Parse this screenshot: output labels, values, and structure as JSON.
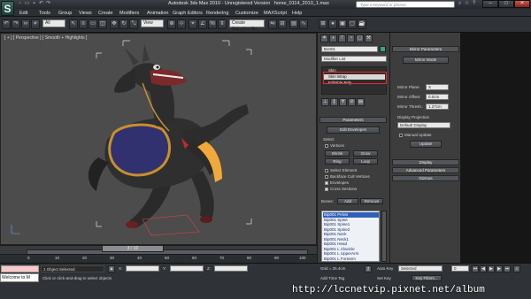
{
  "app": {
    "logo": "S",
    "title": "Autodesk 3ds Max 2010 - Unregistered Version",
    "file_title": "horse_0114_2010_1.max",
    "search_placeholder": "Type a keyword or phrase"
  },
  "menu": [
    "Edit",
    "Tools",
    "Group",
    "Views",
    "Create",
    "Modifiers",
    "Animation",
    "Graph Editors",
    "Rendering",
    "Customize",
    "MAXScript",
    "Help"
  ],
  "toolbar": {
    "selection_filter": "All",
    "view_dropdown": "View",
    "selection_set": "Create Selection Se"
  },
  "viewport": {
    "label": "[ + ] [ Perspective ] [ Smooth + Highlights ]"
  },
  "command_panel": {
    "object_name": "Bon01",
    "modifier_list": "Modifier List",
    "stack": [
      "Skin",
      "Skin Wrap",
      "Editable Poly"
    ]
  },
  "parameters": {
    "title": "Parameters",
    "edit_envelopes": "Edit Envelopes",
    "select_label": "Select",
    "vertices": "Vertices",
    "shrink": "Shrink",
    "grow": "Grow",
    "ring": "Ring",
    "loop": "Loop",
    "select_element": "Select Element",
    "backface": "Backface Cull Vertices",
    "envelopes": "Envelopes",
    "cross_sections": "Cross Sections",
    "bones_label": "Bones:",
    "add": "Add",
    "remove": "Remove",
    "bones": [
      "Bip001 Pelvis",
      "Bip001 Spine",
      "Bip001 Spine1",
      "Bip001 Spine2",
      "Bip001 Neck",
      "Bip001 Neck1",
      "Bip001 Head",
      "Bip001 L Clavicle",
      "Bip001 L UpperArm",
      "Bip001 L Forearm"
    ]
  },
  "mirror": {
    "title": "Mirror Parameters",
    "mirror_mode": "Mirror Mode",
    "mirror_plane_label": "Mirror Plane:",
    "mirror_plane_value": "X",
    "mirror_offset_label": "Mirror Offset:",
    "mirror_offset_value": "0.0cm",
    "mirror_thresh_label": "Mirror Thresh.:",
    "mirror_thresh_value": "1.27cm",
    "display_projection_label": "Display Projection",
    "display_projection_value": "Default Display",
    "manual_update": "Manual Update",
    "update": "Update",
    "display": "Display",
    "advanced": "Advanced Parameters",
    "gizmos": "Gizmos"
  },
  "timeline": {
    "frame": "3 / 10",
    "ticks": [
      "0",
      "10",
      "20",
      "30",
      "40",
      "50",
      "60",
      "70",
      "80",
      "90",
      "100"
    ]
  },
  "status": {
    "welcome": "Welcome to M",
    "selected": "1 Object Selected",
    "hint": "Click or click-and-drag to select objects",
    "x_label": "X:",
    "y_label": "Y:",
    "z_label": "Z:",
    "grid": "Grid = 25.4cm",
    "auto_key": "Auto Key",
    "selected_dropdown": "Selected",
    "set_key": "Set Key",
    "key_filters": "Key Filters...",
    "add_time_tag": "Add Time Tag",
    "frame_field": "0"
  },
  "watermark": "http://lccnetvip.pixnet.net/album"
}
